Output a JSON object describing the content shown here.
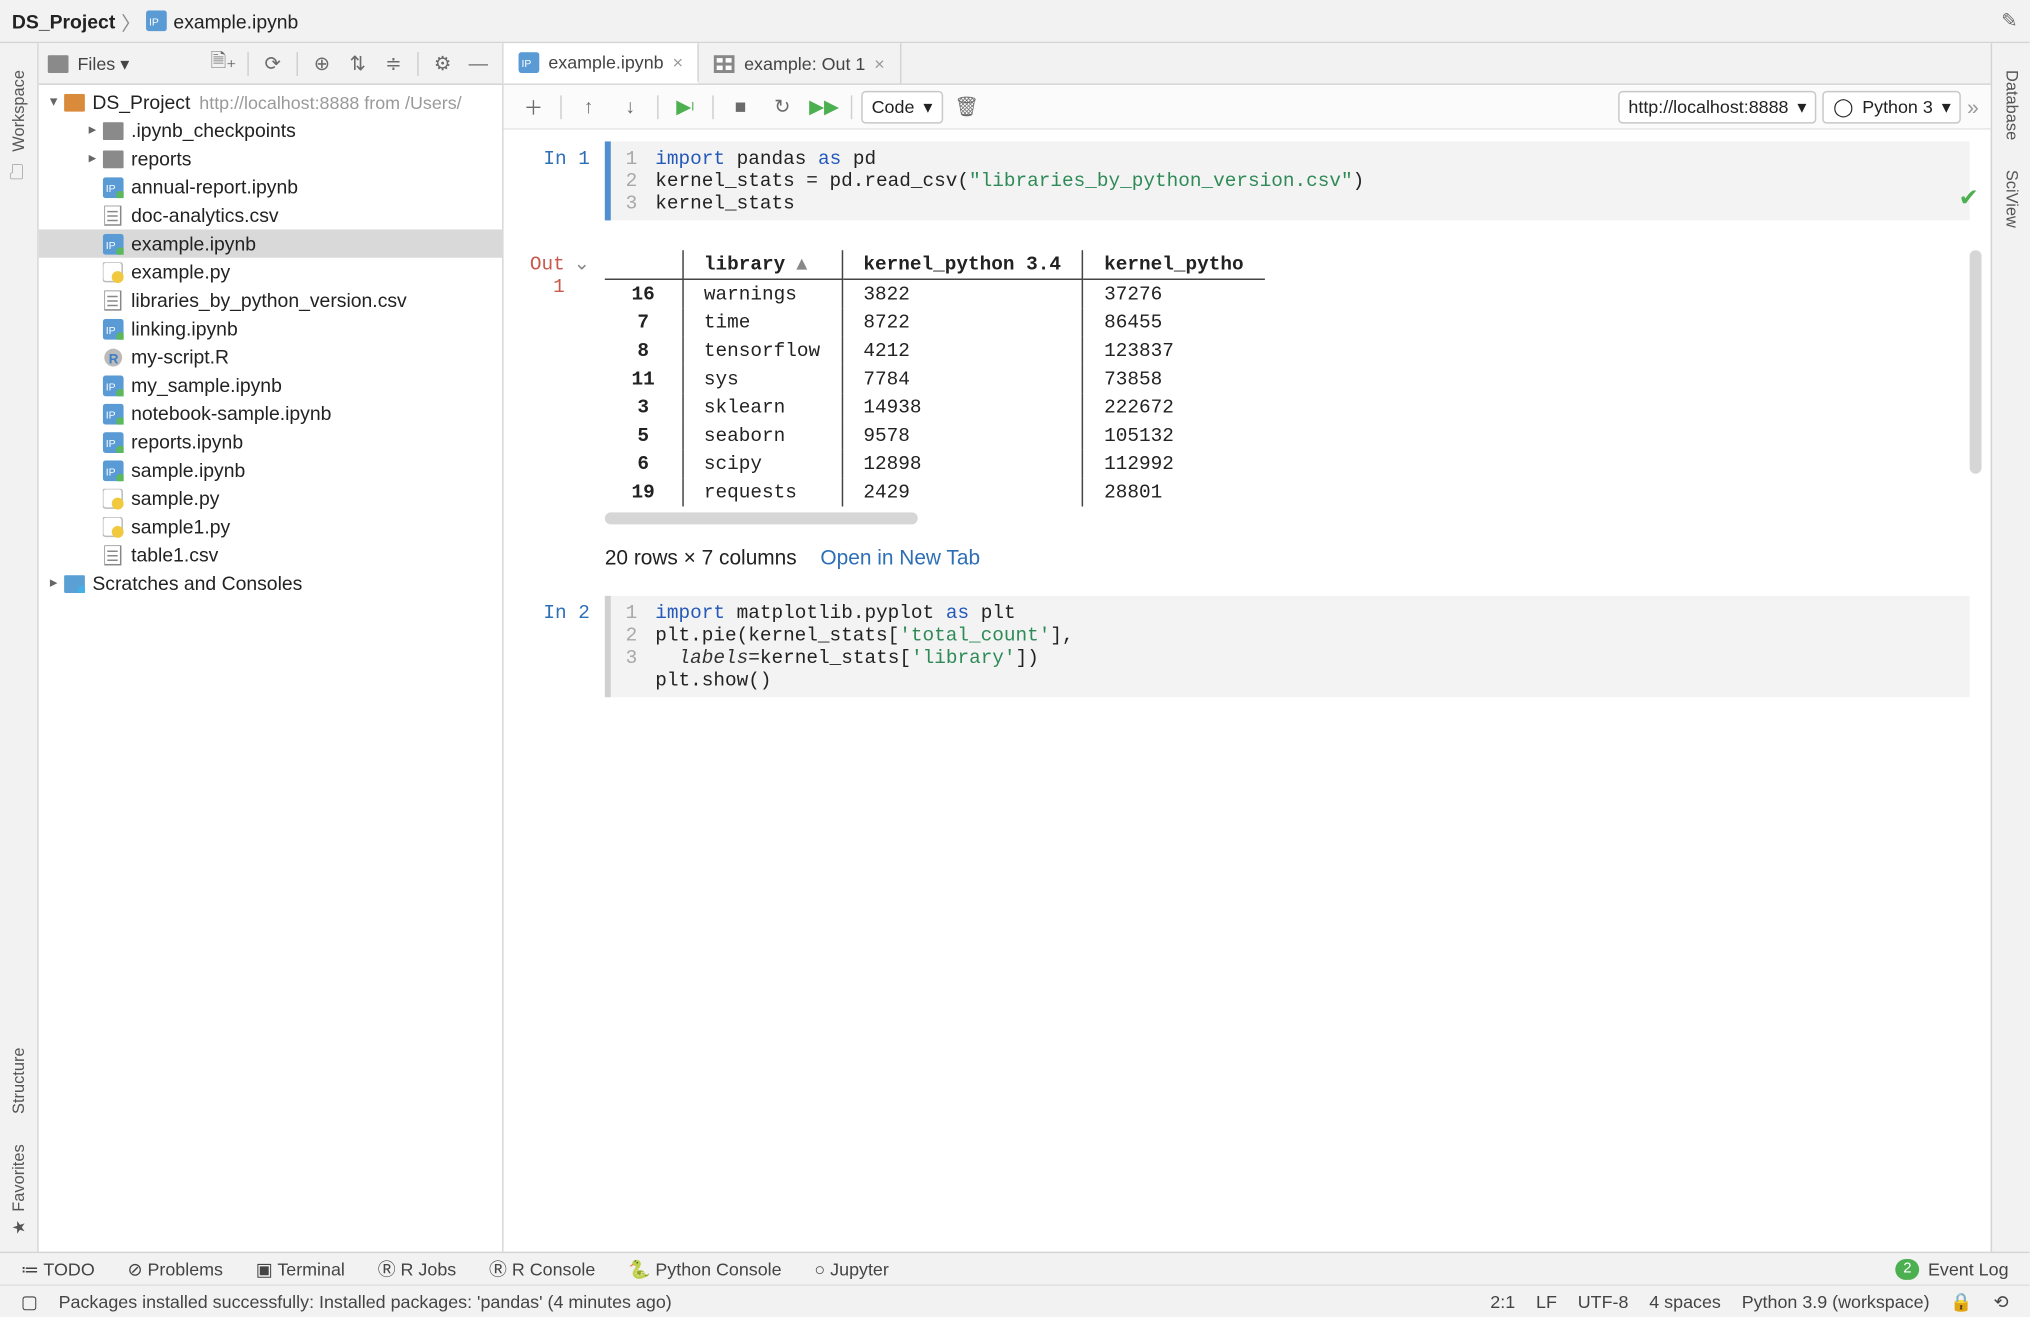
{
  "breadcrumb": {
    "project": "DS_Project",
    "file": "example.ipynb"
  },
  "project_panel": {
    "title": "Files",
    "root": {
      "name": "DS_Project",
      "sub": "http://localhost:8888 from /Users/"
    },
    "items": [
      {
        "name": ".ipynb_checkpoints",
        "type": "folder",
        "depth": 1,
        "toggle": "▸"
      },
      {
        "name": "reports",
        "type": "folder",
        "depth": 1,
        "toggle": "▸"
      },
      {
        "name": "annual-report.ipynb",
        "type": "ipynb",
        "depth": 1
      },
      {
        "name": "doc-analytics.csv",
        "type": "csv",
        "depth": 1
      },
      {
        "name": "example.ipynb",
        "type": "ipynb",
        "depth": 1,
        "selected": true
      },
      {
        "name": "example.py",
        "type": "py",
        "depth": 1
      },
      {
        "name": "libraries_by_python_version.csv",
        "type": "csv",
        "depth": 1
      },
      {
        "name": "linking.ipynb",
        "type": "ipynb",
        "depth": 1
      },
      {
        "name": "my-script.R",
        "type": "r",
        "depth": 1
      },
      {
        "name": "my_sample.ipynb",
        "type": "ipynb",
        "depth": 1
      },
      {
        "name": "notebook-sample.ipynb",
        "type": "ipynb",
        "depth": 1
      },
      {
        "name": "reports.ipynb",
        "type": "ipynb",
        "depth": 1
      },
      {
        "name": "sample.ipynb",
        "type": "ipynb",
        "depth": 1
      },
      {
        "name": "sample.py",
        "type": "py",
        "depth": 1
      },
      {
        "name": "sample1.py",
        "type": "py",
        "depth": 1
      },
      {
        "name": "table1.csv",
        "type": "csv",
        "depth": 1
      }
    ],
    "scratches": "Scratches and Consoles"
  },
  "tabs": [
    {
      "label": "example.ipynb",
      "icon": "ipynb",
      "active": true
    },
    {
      "label": "example: Out 1",
      "icon": "table",
      "active": false
    }
  ],
  "toolbar": {
    "cell_type": "Code",
    "server": "http://localhost:8888",
    "kernel": "Python 3"
  },
  "cells": {
    "in1_label": "In 1",
    "in1_code": [
      {
        "n": "1",
        "html": "<span class='kw'>import</span> pandas <span class='kw'>as</span> pd"
      },
      {
        "n": "2",
        "html": "kernel_stats = pd.read_csv(<span class='str'>\"libraries_by_python_version.csv\"</span>)"
      },
      {
        "n": "3",
        "html": "kernel_stats"
      }
    ],
    "out1_label": "Out 1",
    "out1_headers": [
      "",
      "library",
      "kernel_python 3.4",
      "kernel_pytho"
    ],
    "out1_rows": [
      [
        "16",
        "warnings",
        "3822",
        "37276"
      ],
      [
        "7",
        "time",
        "8722",
        "86455"
      ],
      [
        "8",
        "tensorflow",
        "4212",
        "123837"
      ],
      [
        "11",
        "sys",
        "7784",
        "73858"
      ],
      [
        "3",
        "sklearn",
        "14938",
        "222672"
      ],
      [
        "5",
        "seaborn",
        "9578",
        "105132"
      ],
      [
        "6",
        "scipy",
        "12898",
        "112992"
      ],
      [
        "19",
        "requests",
        "2429",
        "28801"
      ]
    ],
    "out1_footer": "20 rows × 7 columns",
    "out1_link": "Open in New Tab",
    "in2_label": "In 2",
    "in2_code": [
      {
        "n": "1",
        "html": "<span class='kw'>import</span> matplotlib.pyplot <span class='kw'>as</span> plt"
      },
      {
        "n": "2",
        "html": "plt.pie(kernel_stats[<span class='str'>'total_count'</span>],\n  <span class='fn'>labels</span>=kernel_stats[<span class='str'>'library'</span>])"
      },
      {
        "n": "3",
        "html": "plt.show()"
      }
    ]
  },
  "left_tools": {
    "workspace": "Workspace",
    "structure": "Structure",
    "favorites": "Favorites"
  },
  "right_tools": {
    "database": "Database",
    "sciview": "SciView"
  },
  "bottom_tools": {
    "todo": "TODO",
    "problems": "Problems",
    "terminal": "Terminal",
    "rjobs": "R Jobs",
    "rconsole": "R Console",
    "pyconsole": "Python Console",
    "jupyter": "Jupyter",
    "eventlog": "Event Log",
    "eventcount": "2"
  },
  "status": {
    "message": "Packages installed successfully: Installed packages: 'pandas' (4 minutes ago)",
    "pos": "2:1",
    "le": "LF",
    "enc": "UTF-8",
    "indent": "4 spaces",
    "interp": "Python 3.9 (workspace)"
  }
}
